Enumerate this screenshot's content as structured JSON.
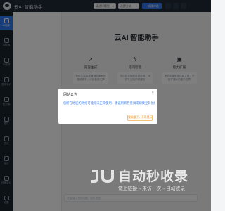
{
  "app": {
    "title": "云AI 智能助手"
  },
  "topbar": {
    "model_select": "请选择模型",
    "mode_select": "选择方式",
    "new_chat_label": "+ 新建对话"
  },
  "sidebar": {
    "items": [
      {
        "label": "AI助手",
        "active": true
      },
      {
        "label": "AI绘画"
      },
      {
        "label": "AI视频"
      },
      {
        "label": "应用中心"
      },
      {
        "label": "知识库"
      },
      {
        "label": "插件"
      },
      {
        "label": "资讯"
      },
      {
        "label": "会员"
      },
      {
        "label": "分销中心"
      },
      {
        "label": "设置"
      }
    ]
  },
  "main": {
    "title": "云AI 智能助手",
    "columns": [
      {
        "icon": "send-icon",
        "title": "内容生成",
        "text": "帮你生成各类营销文案和短视频脚本，以及各类文章"
      },
      {
        "icon": "bolt-icon",
        "title": "提问智能",
        "text": "可以回答你的各类问题，提供专业知识和建议"
      },
      {
        "icon": "doc-icon",
        "title": "能力扩展",
        "text": "提供丰富的插件和工具，不断扩展AI的能力边界"
      }
    ],
    "input_placeholder": "在此输入您的问题，回车发送"
  },
  "dialog": {
    "title": "网站公告",
    "body": "您所在地区的网络可能无法正常使用，建议刷新后重试或切换至其他线路。",
    "button_label": "我知道了，不再提示"
  },
  "watermark": {
    "big_text": "自动秒收录",
    "small_text": "做上链接→来访一次→自动收录"
  },
  "colors": {
    "accent": "#2f7bf5",
    "topbar": "#1f2a36",
    "sidebar": "#1b252f",
    "dialog_button": "#e39b2f"
  }
}
